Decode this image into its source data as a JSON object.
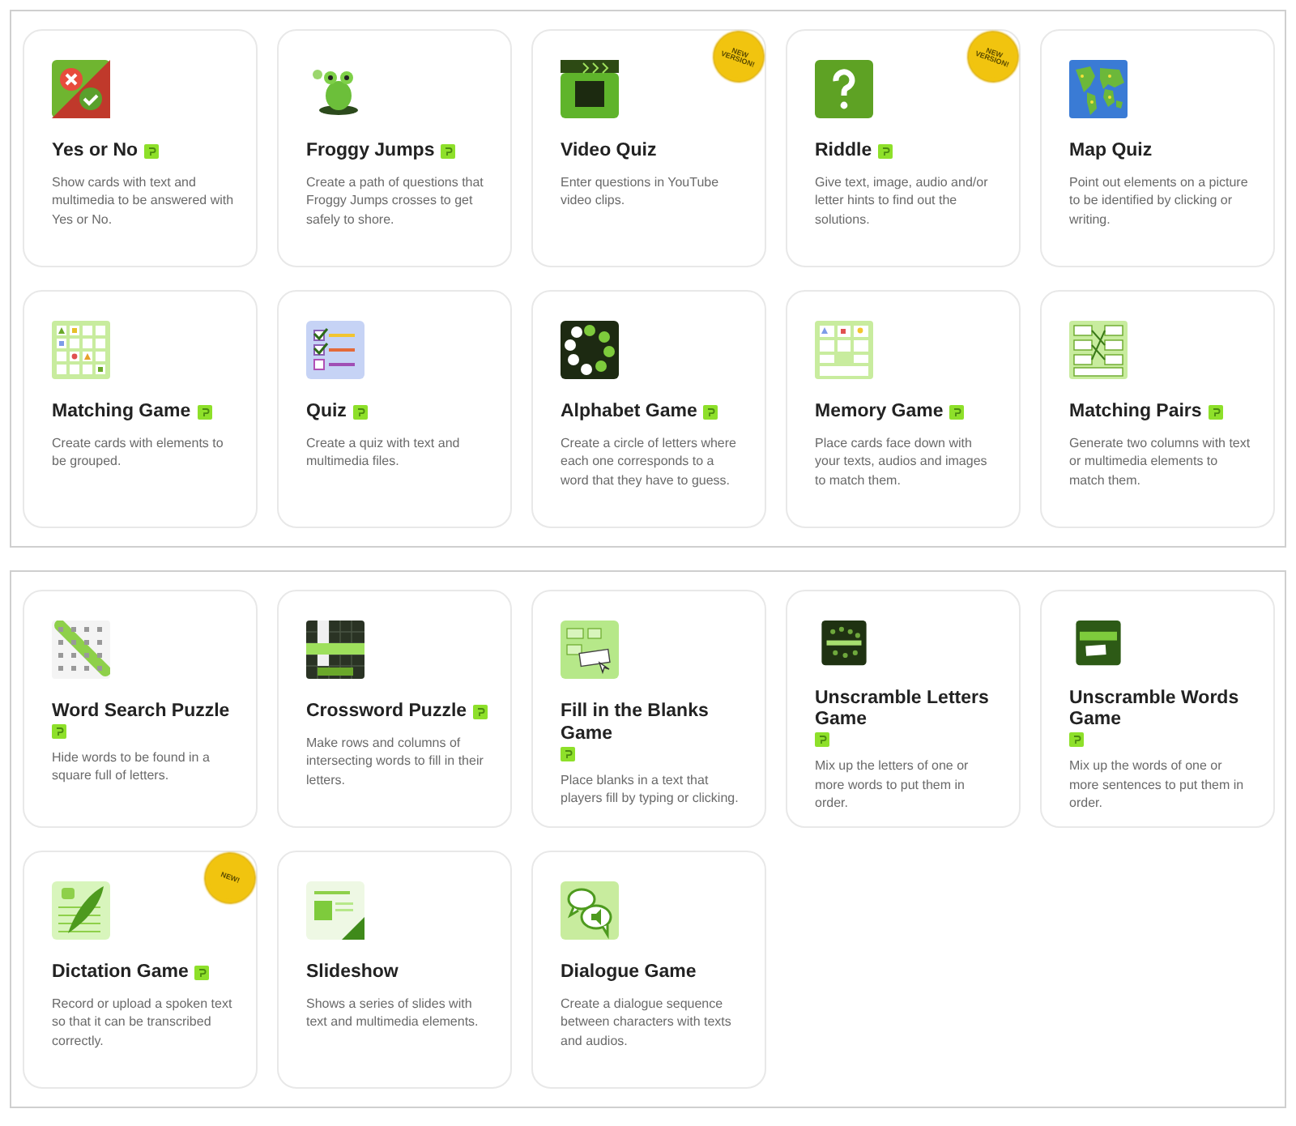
{
  "panels": [
    {
      "cards": [
        {
          "kind": "yesno",
          "title": "Yes or No",
          "tag": true,
          "description": "Show cards with text and multimedia to be answered with Yes or No."
        },
        {
          "kind": "frog",
          "title": "Froggy Jumps",
          "tag": true,
          "description": "Create a path of questions that Froggy Jumps crosses to get safely to shore."
        },
        {
          "kind": "video",
          "title": "Video Quiz",
          "tag": false,
          "description": "Enter questions in YouTube video clips.",
          "badge": "NEW VERSION!"
        },
        {
          "kind": "riddle",
          "title": "Riddle",
          "tag": true,
          "description": "Give text, image, audio and/or letter hints to find out the solutions.",
          "badge": "NEW VERSION!"
        },
        {
          "kind": "map",
          "title": "Map Quiz",
          "tag": false,
          "description": "Point out elements on a picture to be identified by clicking or writing."
        },
        {
          "kind": "matching",
          "title": "Matching Game",
          "tag": true,
          "description": "Create cards with elements to be grouped."
        },
        {
          "kind": "quiz",
          "title": "Quiz",
          "tag": true,
          "description": "Create a quiz with text and multimedia files."
        },
        {
          "kind": "alphabet",
          "title": "Alphabet Game",
          "tag": true,
          "description": "Create a circle of letters where each one corresponds to a word that they have to guess."
        },
        {
          "kind": "memory",
          "title": "Memory Game",
          "tag": true,
          "description": "Place cards face down with your texts, audios and images to match them."
        },
        {
          "kind": "pairs",
          "title": "Matching Pairs",
          "tag": true,
          "description": "Generate two columns with text or multimedia elements to match them."
        }
      ]
    },
    {
      "cards": [
        {
          "kind": "wordsearch",
          "title": "Word Search Puzzle",
          "tag": true,
          "description": "Hide words to be found in a square full of letters."
        },
        {
          "kind": "crossword",
          "title": "Crossword Puzzle",
          "tag": true,
          "description": "Make rows and columns of intersecting words to fill in their letters."
        },
        {
          "kind": "blanks",
          "title": "Fill in the Blanks Game",
          "tag": true,
          "description": "Place blanks in a text that players fill by typing or clicking."
        },
        {
          "kind": "letters",
          "title": "Unscramble Letters Game",
          "tag": true,
          "description": "Mix up the letters of one or more words to put them in order."
        },
        {
          "kind": "words",
          "title": "Unscramble Words Game",
          "tag": true,
          "description": "Mix up the words of one or more sentences to put them in order."
        },
        {
          "kind": "dictation",
          "title": "Dictation Game",
          "tag": true,
          "description": "Record or upload a spoken text so that it can be transcribed correctly.",
          "badge": "NEW!"
        },
        {
          "kind": "slideshow",
          "title": "Slideshow",
          "tag": false,
          "description": "Shows a series of slides with text and multimedia elements."
        },
        {
          "kind": "dialogue",
          "title": "Dialogue Game",
          "tag": false,
          "description": "Create a dialogue sequence between characters with texts and audios."
        }
      ]
    }
  ]
}
